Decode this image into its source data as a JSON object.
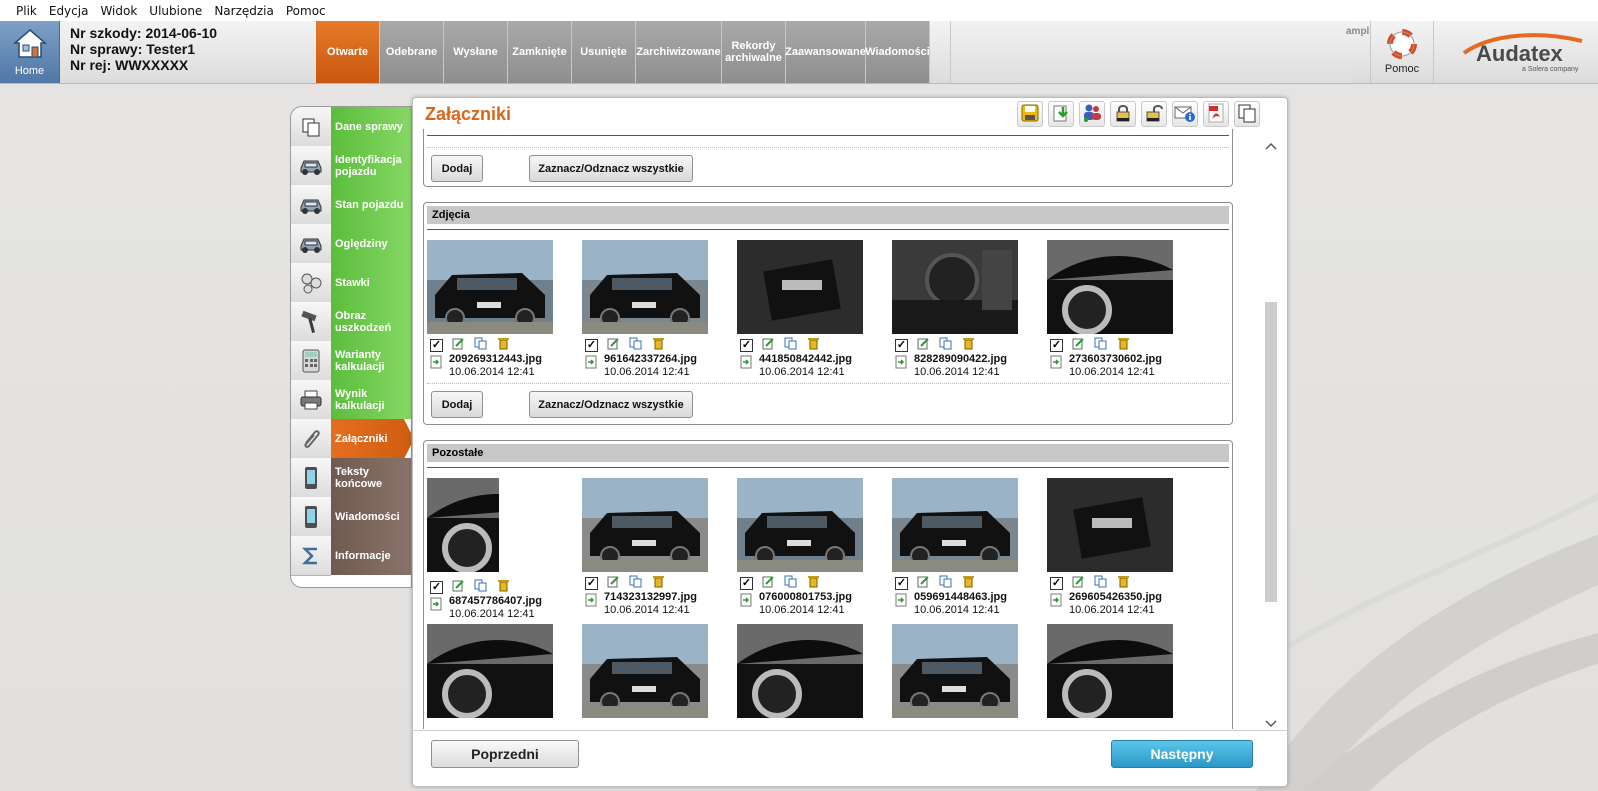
{
  "menu": [
    "Plik",
    "Edycja",
    "Widok",
    "Ulubione",
    "Narzędzia",
    "Pomoc"
  ],
  "header": {
    "home_label": "Home",
    "claim_no": "Nr szkody: 2014-06-10",
    "case_no": "Nr sprawy: Tester1",
    "reg_no": "Nr rej: WWXXXXX",
    "tabs": [
      "Otwarte",
      "Odebrane",
      "Wysłane",
      "Zamknięte",
      "Usunięte",
      "Zarchiwizowane",
      "Rekordy archiwalne",
      "Zaawansowane",
      "Wiadomości"
    ],
    "active_tab": "Otwarte",
    "user": "ampl",
    "help_label": "Pomoc",
    "logo_text": "Audatex",
    "logo_sub": "a Solera company"
  },
  "nav": [
    {
      "label": "Dane sprawy",
      "icon": "copy-icon",
      "state": "done"
    },
    {
      "label": "Identyfikacja pojazdu",
      "icon": "car-icon",
      "state": "done"
    },
    {
      "label": "Stan pojazdu",
      "icon": "car-icon",
      "state": "done"
    },
    {
      "label": "Oględziny",
      "icon": "car-icon",
      "state": "done"
    },
    {
      "label": "Stawki",
      "icon": "coins-icon",
      "state": "done"
    },
    {
      "label": "Obraz uszkodzeń",
      "icon": "hammer-icon",
      "state": "done"
    },
    {
      "label": "Warianty kalkulacji",
      "icon": "calculator-icon",
      "state": "done"
    },
    {
      "label": "Wynik kalkulacji",
      "icon": "printer-icon",
      "state": "done"
    },
    {
      "label": "Załączniki",
      "icon": "paperclip-icon",
      "state": "active"
    },
    {
      "label": "Teksty końcowe",
      "icon": "phone-icon",
      "state": "todo"
    },
    {
      "label": "Wiadomości",
      "icon": "phone-icon",
      "state": "todo"
    },
    {
      "label": "Informacje",
      "icon": "sigma-icon",
      "state": "todo"
    }
  ],
  "panel": {
    "title": "Załączniki",
    "toolbar": [
      "save-icon",
      "download-icon",
      "add-users-icon",
      "lock-icon",
      "unlock-icon",
      "mail-info-icon",
      "pdf-icon",
      "copy-icon"
    ],
    "add_label": "Dodaj",
    "toggle_label": "Zaznacz/Odznacz wszystkie",
    "photos_title": "Zdjęcia",
    "others_title": "Pozostałe",
    "photos": [
      {
        "name": "209269312443.jpg",
        "date": "10.06.2014 12:41"
      },
      {
        "name": "961642337264.jpg",
        "date": "10.06.2014 12:41"
      },
      {
        "name": "441850842442.jpg",
        "date": "10.06.2014 12:41"
      },
      {
        "name": "828289090422.jpg",
        "date": "10.06.2014 12:41"
      },
      {
        "name": "273603730602.jpg",
        "date": "10.06.2014 12:41"
      }
    ],
    "others": [
      {
        "name": "687457786407.jpg",
        "date": "10.06.2014 12:41"
      },
      {
        "name": "714323132997.jpg",
        "date": "10.06.2014 12:41"
      },
      {
        "name": "076000801753.jpg",
        "date": "10.06.2014 12:41"
      },
      {
        "name": "059691448463.jpg",
        "date": "10.06.2014 12:41"
      },
      {
        "name": "269605426350.jpg",
        "date": "10.06.2014 12:41"
      }
    ],
    "prev_label": "Poprzedni",
    "next_label": "Następny"
  },
  "colors": {
    "accent": "#d9661a",
    "green": "#5cbd3c",
    "brown": "#6f5a51",
    "next": "#2b97c8"
  }
}
